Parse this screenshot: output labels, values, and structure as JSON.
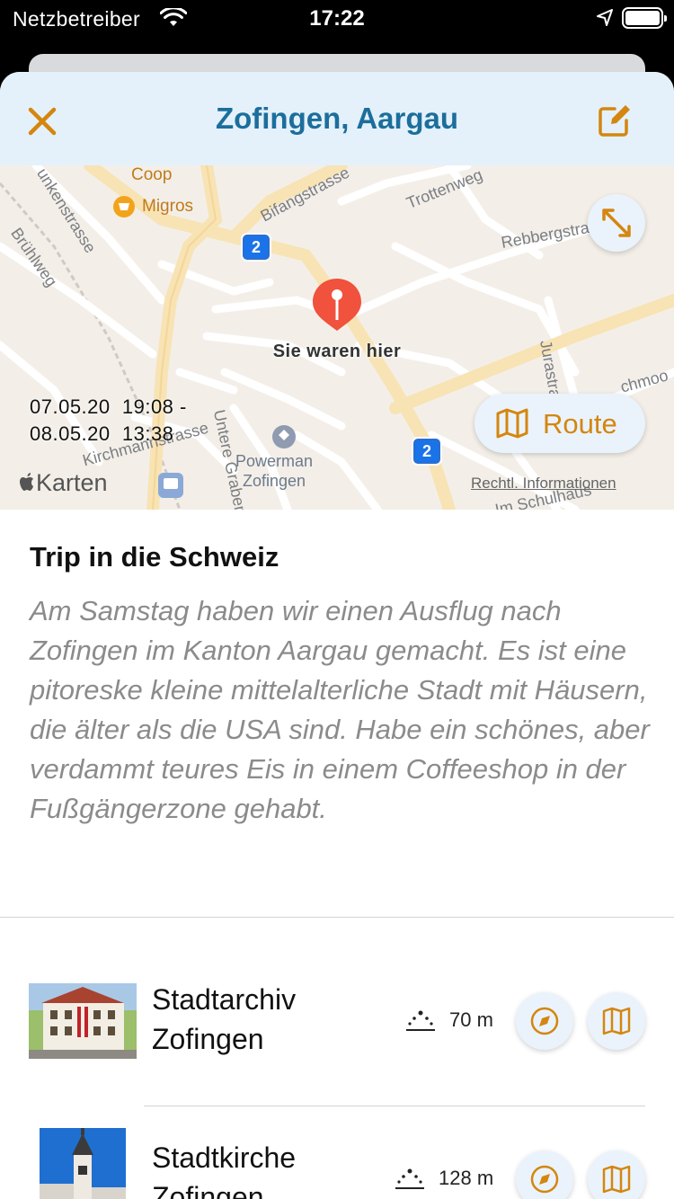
{
  "status": {
    "carrier": "Netzbetreiber",
    "time": "17:22"
  },
  "header": {
    "title": "Zofingen, Aargau",
    "close_icon": "close-icon",
    "edit_icon": "edit-icon"
  },
  "map": {
    "streets": [
      "Coop",
      "Migros",
      "Bifangstrasse",
      "Trottenweg",
      "Rebbergstrasse",
      "Brühlweg",
      "unkenstrasse",
      "Jurastrasse",
      "chmoo",
      "Untere Graben",
      "Kirchmannstrasse",
      "Im Schulhaus"
    ],
    "pin_label": "Sie waren hier",
    "date_start": "07.05.20  19:08 -",
    "date_end": "08.05.20  13:38",
    "poi": "Powerman\nZofingen",
    "poi_line1": "Powerman",
    "poi_line2": "Zofingen",
    "route_shield": "2",
    "brand": "Karten",
    "legal": "Rechtl. Informationen",
    "route_label": "Route",
    "accent": "#d4860f"
  },
  "trip": {
    "title": "Trip in die Schweiz",
    "description": "Am Samstag haben wir einen Ausflug nach Zofingen im Kanton Aargau gemacht. Es ist eine pitoreske kleine mittelalterliche Stadt mit Häusern, die älter als die USA sind. Habe ein schönes, aber verdammt teures Eis in einem Coffeeshop in der Fußgängerzone gehabt."
  },
  "places": [
    {
      "name_line1": "Stadtarchiv",
      "name_line2": "Zofingen",
      "distance": "70 m"
    },
    {
      "name_line1": "Stadtkirche",
      "name_line2": "Zofingen",
      "distance": "128 m"
    }
  ]
}
